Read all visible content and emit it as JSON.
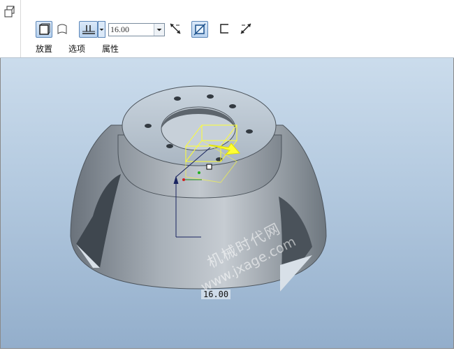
{
  "toolbar": {
    "tabs": [
      "放置",
      "选项",
      "属性"
    ],
    "depth": {
      "value": "16.00"
    }
  },
  "viewport": {
    "dimension_value": "16.00",
    "watermark": {
      "line1": "机械时代网",
      "line2": "www.jxage.com"
    }
  },
  "colors": {
    "background_top": "#cbdcec",
    "background_bottom": "#93aecb",
    "model": "#8a939c",
    "feature_preview": "#ffff33"
  }
}
